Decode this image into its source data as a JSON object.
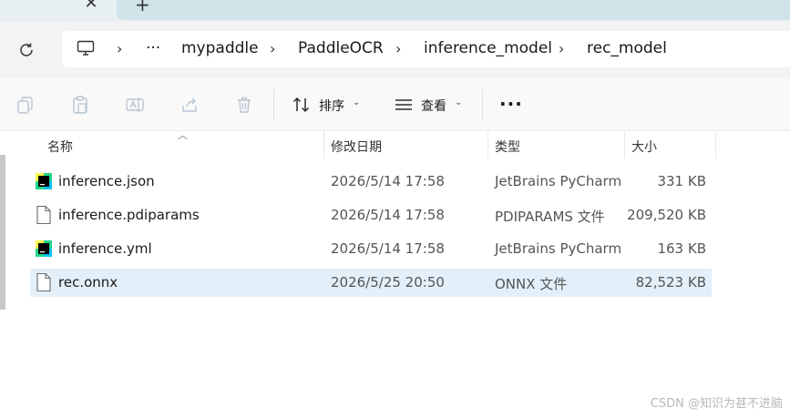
{
  "tabs": {
    "close_glyph": "✕",
    "new_tab_glyph": "+"
  },
  "address": {
    "ellipsis": "···",
    "separator": "›",
    "crumbs": [
      "mypaddle",
      "PaddleOCR",
      "inference_model",
      "rec_model"
    ]
  },
  "toolbar": {
    "sort_label": "排序",
    "view_label": "查看",
    "more_glyph": "···",
    "chevron": "⌄"
  },
  "columns": {
    "name": "名称",
    "modified": "修改日期",
    "type": "类型",
    "size": "大小"
  },
  "files": [
    {
      "name": "inference.json",
      "modified": "2026/5/14 17:58",
      "type": "JetBrains PyCharm",
      "size": "331 KB",
      "icon": "pycharm-icon",
      "selected": false
    },
    {
      "name": "inference.pdiparams",
      "modified": "2026/5/14 17:58",
      "type": "PDIPARAMS 文件",
      "size": "209,520 KB",
      "icon": "file-icon",
      "selected": false
    },
    {
      "name": "inference.yml",
      "modified": "2026/5/14 17:58",
      "type": "JetBrains PyCharm",
      "size": "163 KB",
      "icon": "pycharm-icon",
      "selected": false
    },
    {
      "name": "rec.onnx",
      "modified": "2026/5/25 20:50",
      "type": "ONNX 文件",
      "size": "82,523 KB",
      "icon": "file-icon",
      "selected": true
    }
  ],
  "watermark": "CSDN @知识为甚不进脑",
  "colors": {
    "selected_row": "#e3eff9",
    "tab_strip": "#cfe3e9",
    "pycharm_green": "#21d789"
  }
}
